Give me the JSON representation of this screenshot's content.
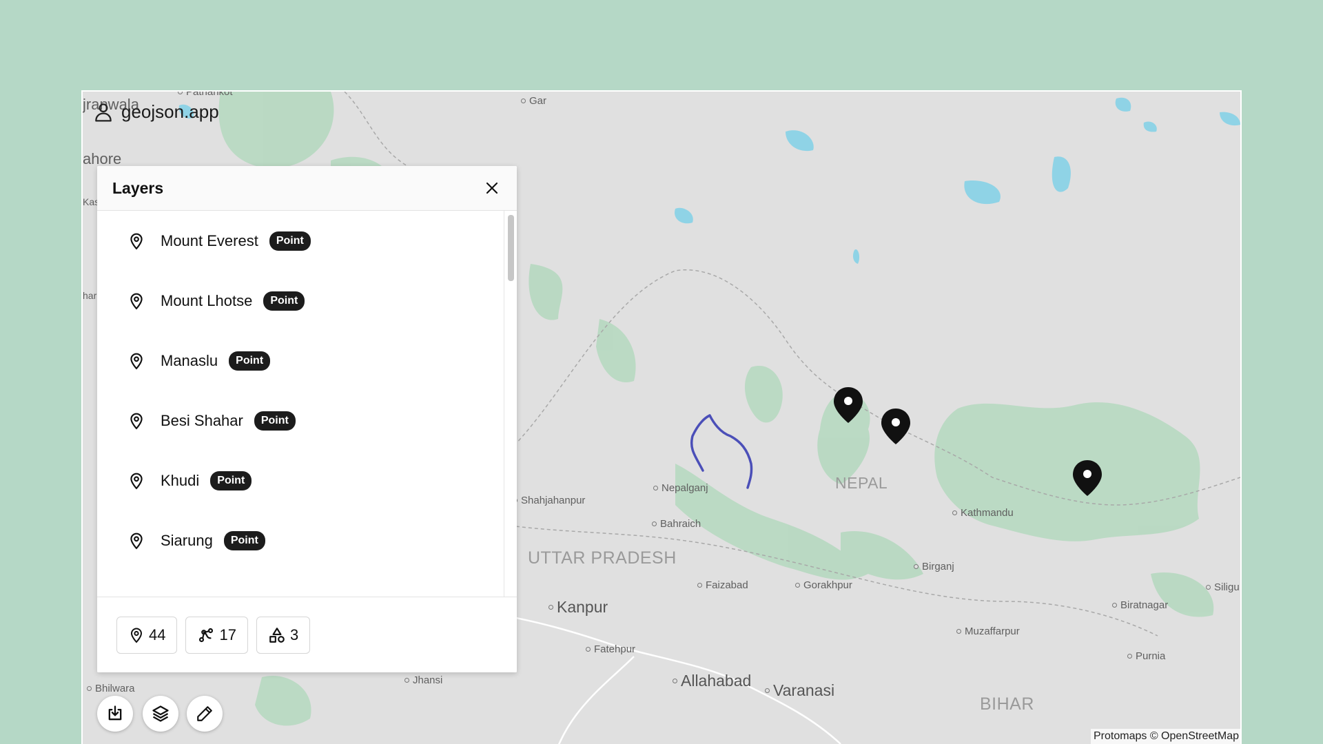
{
  "app": {
    "brand": "geojson.app"
  },
  "layers_panel": {
    "title": "Layers",
    "items": [
      {
        "name": "Mount Everest",
        "type": "Point"
      },
      {
        "name": "Mount Lhotse",
        "type": "Point"
      },
      {
        "name": "Manaslu",
        "type": "Point"
      },
      {
        "name": "Besi Shahar",
        "type": "Point"
      },
      {
        "name": "Khudi",
        "type": "Point"
      },
      {
        "name": "Siarung",
        "type": "Point"
      }
    ],
    "counts": {
      "points": "44",
      "lines": "17",
      "polygons": "3"
    }
  },
  "map": {
    "places": [
      {
        "label": "Gar"
      },
      {
        "label": "Nepalganj"
      },
      {
        "label": "Shahjahanpur"
      },
      {
        "label": "Bahraich"
      },
      {
        "label": "Kathmandu"
      },
      {
        "label": "Birganj"
      },
      {
        "label": "Faizabad"
      },
      {
        "label": "Gorakhpur"
      },
      {
        "label": "Biratnagar"
      },
      {
        "label": "Siligu"
      },
      {
        "label": "Muzaffarpur"
      },
      {
        "label": "Fatehpur"
      },
      {
        "label": "Purnia"
      },
      {
        "label": "Jhansi"
      },
      {
        "label": "Bhilwara"
      },
      {
        "label": "Pathankot"
      },
      {
        "label": "Kanpur"
      },
      {
        "label": "Allahabad"
      },
      {
        "label": "Varanasi"
      },
      {
        "label": "jranwala"
      },
      {
        "label": "ahore"
      },
      {
        "label": "Kas"
      },
      {
        "label": "har"
      }
    ],
    "regions": [
      {
        "label": "NEPAL"
      },
      {
        "label": "UTTAR PRADESH"
      },
      {
        "label": "BIHAR"
      }
    ],
    "route_color": "#4b4fb8",
    "marker_color": "#111111",
    "attribution": "Protomaps © OpenStreetMap"
  },
  "toolbar": {
    "import_icon": "import-icon",
    "layers_icon": "layers-icon",
    "edit_icon": "pencil-icon"
  }
}
